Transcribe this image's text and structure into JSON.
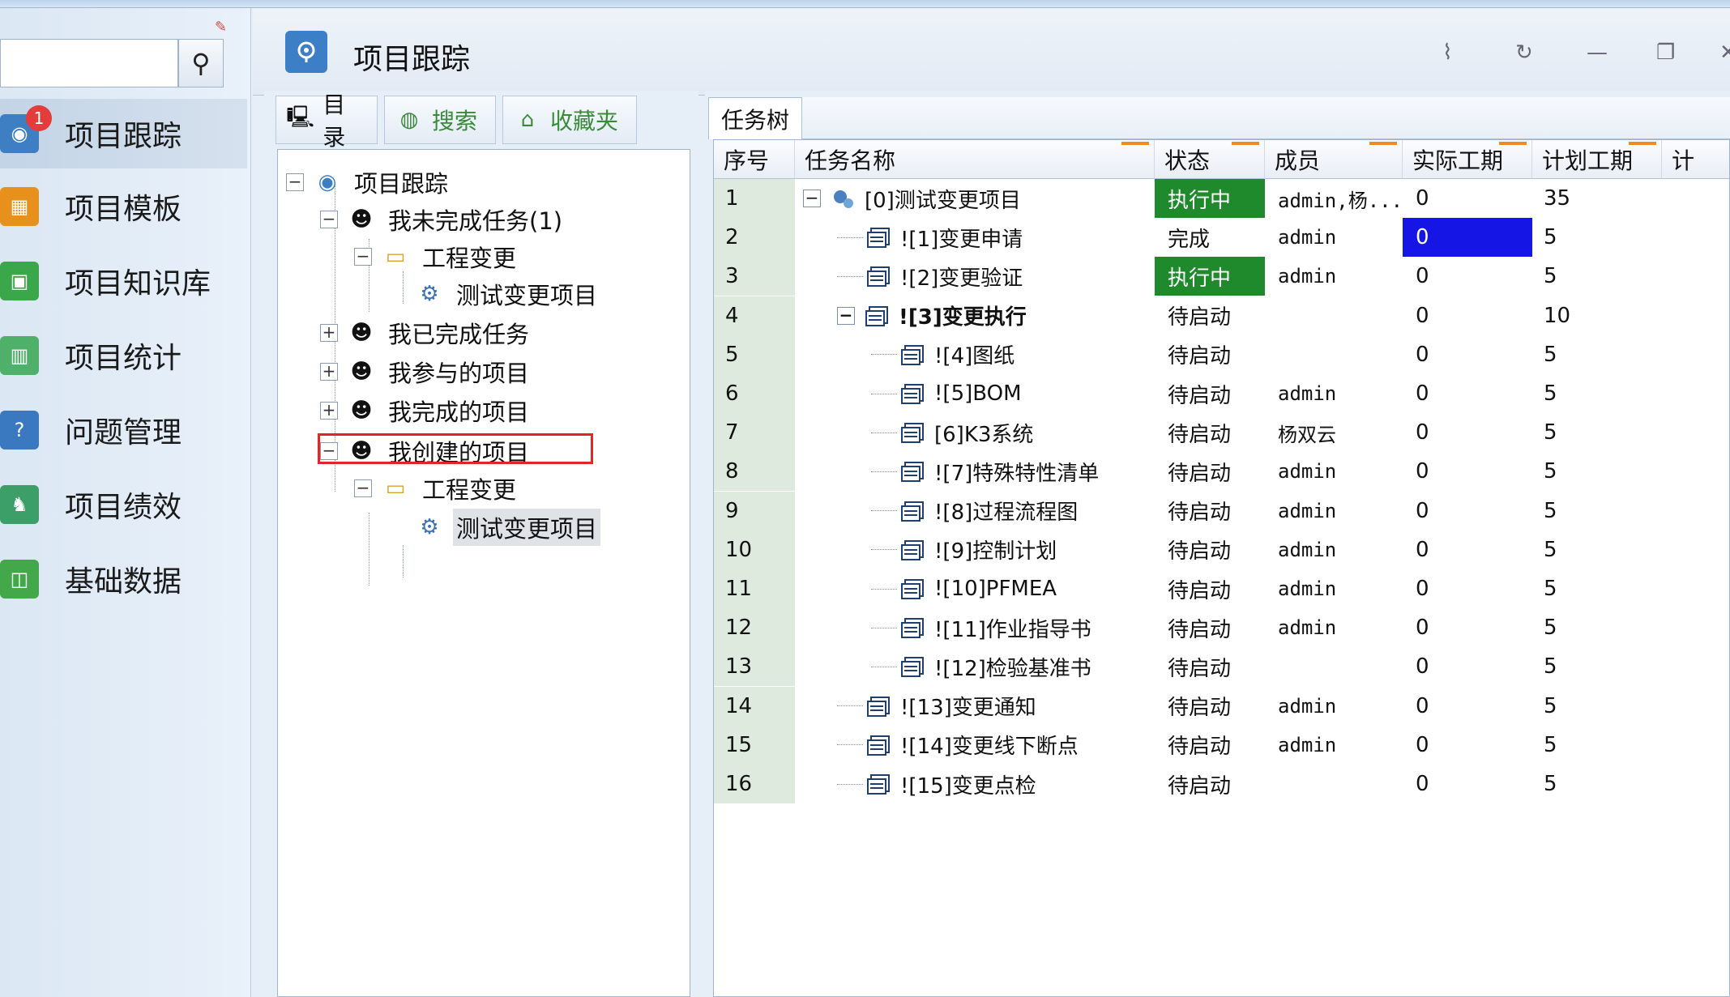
{
  "app": {
    "title": "项目跟踪"
  },
  "nav": {
    "badge": "1",
    "items": [
      {
        "label": "项目跟踪"
      },
      {
        "label": "项目模板"
      },
      {
        "label": "项目知识库"
      },
      {
        "label": "项目统计"
      },
      {
        "label": "问题管理"
      },
      {
        "label": "项目绩效"
      },
      {
        "label": "基础数据"
      }
    ]
  },
  "left_tabs": {
    "catalog": "目录",
    "search": "搜索",
    "favorites": "收藏夹"
  },
  "tree": {
    "root": "项目跟踪",
    "n1": "我未完成任务(1)",
    "n1a": "工程变更",
    "n1a1": "测试变更项目",
    "n2": "我已完成任务",
    "n3": "我参与的项目",
    "n4": "我完成的项目",
    "n5": "我创建的项目",
    "n5a": "工程变更",
    "n5a1": "测试变更项目"
  },
  "task_tab": "任务树",
  "grid": {
    "headers": {
      "seq": "序号",
      "name": "任务名称",
      "status": "状态",
      "member": "成员",
      "actual": "实际工期",
      "plan": "计划工期",
      "extra": "计"
    },
    "rows": [
      {
        "seq": "1",
        "name": "[0]测试变更项目",
        "status": "执行中",
        "member": "admin,杨...",
        "actual": "0",
        "plan": "35"
      },
      {
        "seq": "2",
        "name": "![1]变更申请",
        "status": "完成",
        "member": "admin",
        "actual": "0",
        "plan": "5"
      },
      {
        "seq": "3",
        "name": "![2]变更验证",
        "status": "执行中",
        "member": "admin",
        "actual": "0",
        "plan": "5"
      },
      {
        "seq": "4",
        "name": "![3]变更执行",
        "status": "待启动",
        "member": "",
        "actual": "0",
        "plan": "10"
      },
      {
        "seq": "5",
        "name": "![4]图纸",
        "status": "待启动",
        "member": "",
        "actual": "0",
        "plan": "5"
      },
      {
        "seq": "6",
        "name": "![5]BOM",
        "status": "待启动",
        "member": "admin",
        "actual": "0",
        "plan": "5"
      },
      {
        "seq": "7",
        "name": "[6]K3系统",
        "status": "待启动",
        "member": "杨双云",
        "actual": "0",
        "plan": "5"
      },
      {
        "seq": "8",
        "name": "![7]特殊特性清单",
        "status": "待启动",
        "member": "admin",
        "actual": "0",
        "plan": "5"
      },
      {
        "seq": "9",
        "name": "![8]过程流程图",
        "status": "待启动",
        "member": "admin",
        "actual": "0",
        "plan": "5"
      },
      {
        "seq": "10",
        "name": "![9]控制计划",
        "status": "待启动",
        "member": "admin",
        "actual": "0",
        "plan": "5"
      },
      {
        "seq": "11",
        "name": "![10]PFMEA",
        "status": "待启动",
        "member": "admin",
        "actual": "0",
        "plan": "5"
      },
      {
        "seq": "12",
        "name": "![11]作业指导书",
        "status": "待启动",
        "member": "admin",
        "actual": "0",
        "plan": "5"
      },
      {
        "seq": "13",
        "name": "![12]检验基准书",
        "status": "待启动",
        "member": "",
        "actual": "0",
        "plan": "5"
      },
      {
        "seq": "14",
        "name": "![13]变更通知",
        "status": "待启动",
        "member": "admin",
        "actual": "0",
        "plan": "5"
      },
      {
        "seq": "15",
        "name": "![14]变更线下断点",
        "status": "待启动",
        "member": "admin",
        "actual": "0",
        "plan": "5"
      },
      {
        "seq": "16",
        "name": "![15]变更点检",
        "status": "待启动",
        "member": "",
        "actual": "0",
        "plan": "5"
      }
    ]
  },
  "colors": {
    "running": "#1f8a2c",
    "selected_cell": "#1515e6",
    "highlight_box": "#e0262a",
    "header_mark": "#f08a24"
  }
}
